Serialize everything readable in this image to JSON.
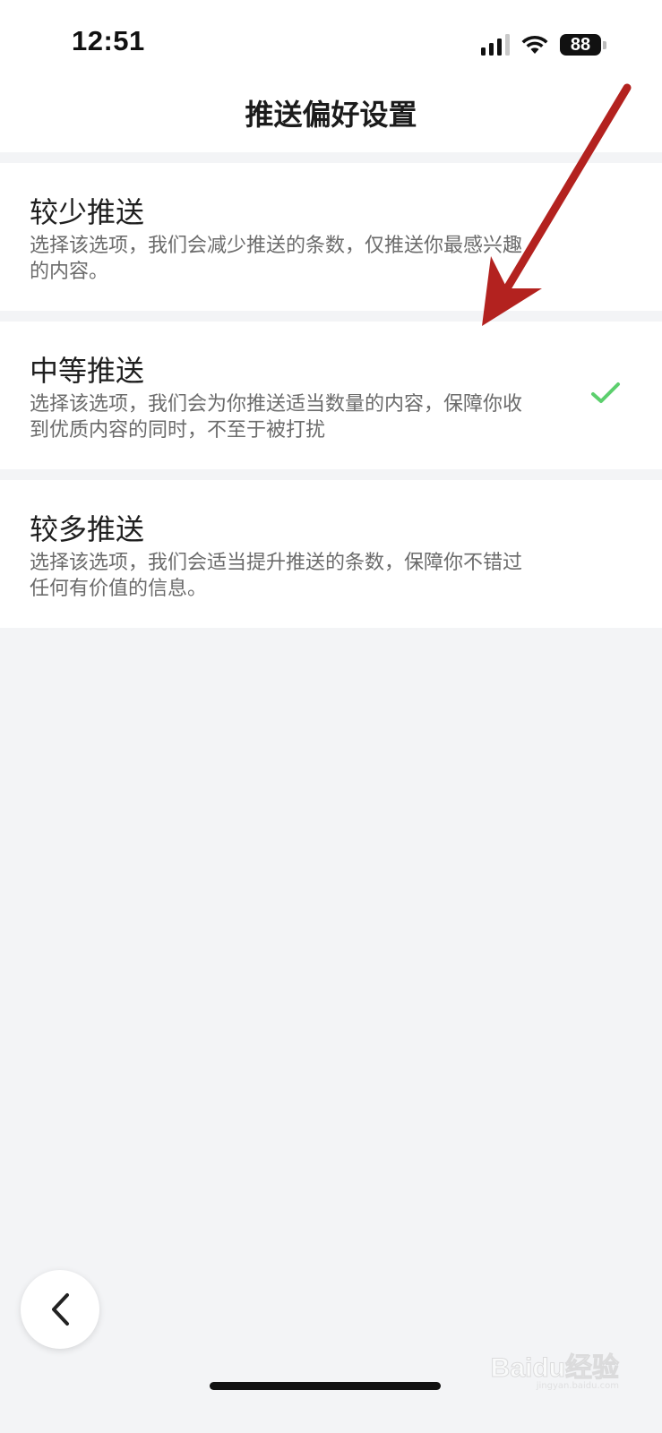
{
  "status_bar": {
    "time": "12:51",
    "battery_level": "88"
  },
  "header": {
    "title": "推送偏好设置"
  },
  "options": [
    {
      "title": "较少推送",
      "description": "选择该选项，我们会减少推送的条数，仅推送你最感兴趣的内容。",
      "selected": false
    },
    {
      "title": "中等推送",
      "description": "选择该选项，我们会为你推送适当数量的内容，保障你收到优质内容的同时，不至于被打扰",
      "selected": true
    },
    {
      "title": "较多推送",
      "description": "选择该选项，我们会适当提升推送的条数，保障你不错过任何有价值的信息。",
      "selected": false
    }
  ],
  "colors": {
    "check_green": "#5ccf6d",
    "arrow_red": "#b3221f",
    "page_bg": "#f3f4f6"
  },
  "watermark": {
    "text": "Baidu经验",
    "sub": "jingyan.baidu.com"
  }
}
